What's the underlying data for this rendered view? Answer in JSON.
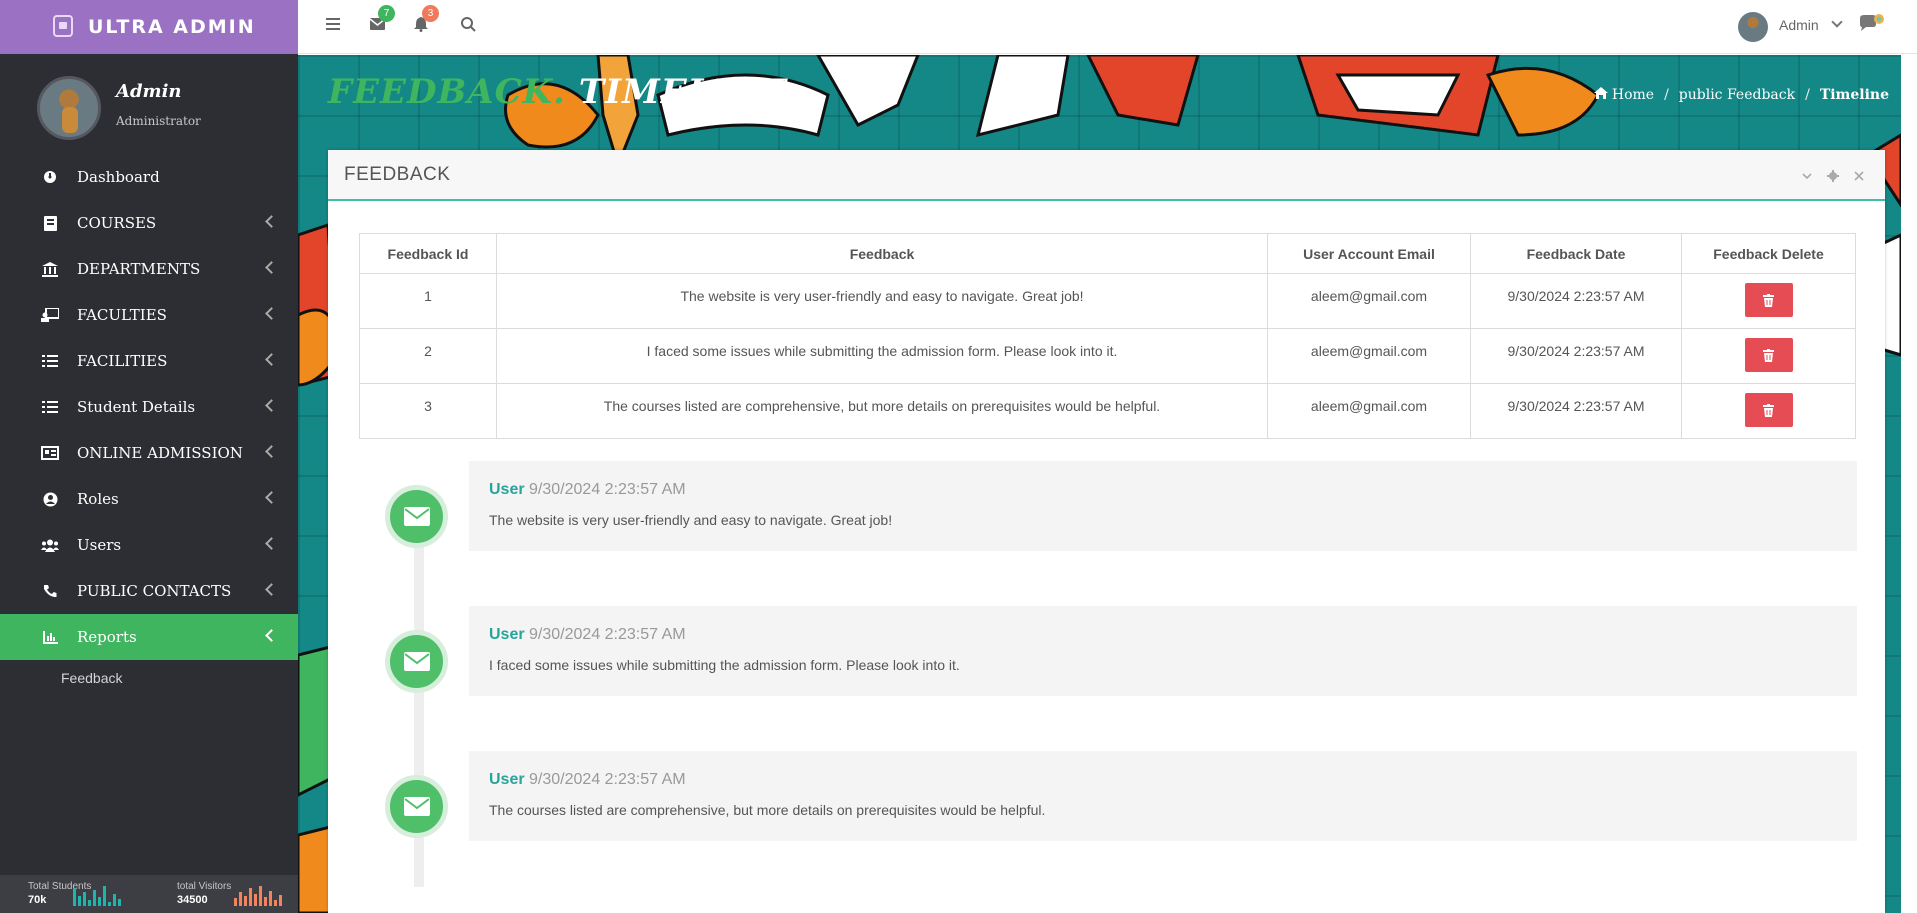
{
  "brand": {
    "name": "ULTRA ADMIN"
  },
  "profile": {
    "name": "Admin",
    "role": "Administrator"
  },
  "sidebar": {
    "items": [
      {
        "label": "Dashboard",
        "icon": "dashboard-icon"
      },
      {
        "label": "COURSES",
        "icon": "book-icon"
      },
      {
        "label": "DEPARTMENTS",
        "icon": "bank-icon"
      },
      {
        "label": "FACULTIES",
        "icon": "teacher-icon"
      },
      {
        "label": "FACILITIES",
        "icon": "list-icon"
      },
      {
        "label": "Student Details",
        "icon": "list-icon"
      },
      {
        "label": "ONLINE ADMISSION",
        "icon": "id-card-icon"
      },
      {
        "label": "Roles",
        "icon": "user-circle-icon"
      },
      {
        "label": "Users",
        "icon": "users-icon"
      },
      {
        "label": "PUBLIC CONTACTS",
        "icon": "phone-icon"
      },
      {
        "label": "Reports",
        "icon": "bar-chart-icon"
      }
    ],
    "submenu": [
      {
        "label": "Feedback"
      }
    ],
    "footer": {
      "students_label": "Total Students",
      "students_value": "70k",
      "visitors_label": "total Visitors",
      "visitors_value": "34500"
    }
  },
  "topbar": {
    "messages_count": "7",
    "notifications_count": "3",
    "user_label": "Admin"
  },
  "hero": {
    "title_part1": "FEEDBACK.",
    "title_part2": "TIMELINE",
    "breadcrumb": [
      "Home",
      "public Feedback",
      "Timeline"
    ]
  },
  "panel": {
    "title": "FEEDBACK",
    "table": {
      "headers": [
        "Feedback Id",
        "Feedback",
        "User Account Email",
        "Feedback Date",
        "Feedback Delete"
      ],
      "rows": [
        {
          "id": "1",
          "feedback": "The website is very user-friendly and easy to navigate. Great job!",
          "email": "aleem@gmail.com",
          "date": "9/30/2024 2:23:57 AM"
        },
        {
          "id": "2",
          "feedback": "I faced some issues while submitting the admission form. Please look into it.",
          "email": "aleem@gmail.com",
          "date": "9/30/2024 2:23:57 AM"
        },
        {
          "id": "3",
          "feedback": "The courses listed are comprehensive, but more details on prerequisites would be helpful.",
          "email": "aleem@gmail.com",
          "date": "9/30/2024 2:23:57 AM"
        }
      ]
    },
    "timeline": [
      {
        "user": "User",
        "date": "9/30/2024 2:23:57 AM",
        "text": "The website is very user-friendly and easy to navigate. Great job!"
      },
      {
        "user": "User",
        "date": "9/30/2024 2:23:57 AM",
        "text": "I faced some issues while submitting the admission form. Please look into it."
      },
      {
        "user": "User",
        "date": "9/30/2024 2:23:57 AM",
        "text": "The courses listed are comprehensive, but more details on prerequisites would be helpful."
      }
    ]
  },
  "colors": {
    "brand": "#9b72c3",
    "sidebar_bg": "#2d2e33",
    "active": "#3fb55f",
    "hero_teal": "#148887",
    "delete_red": "#e64c54",
    "timeline_user": "#27a59a"
  }
}
